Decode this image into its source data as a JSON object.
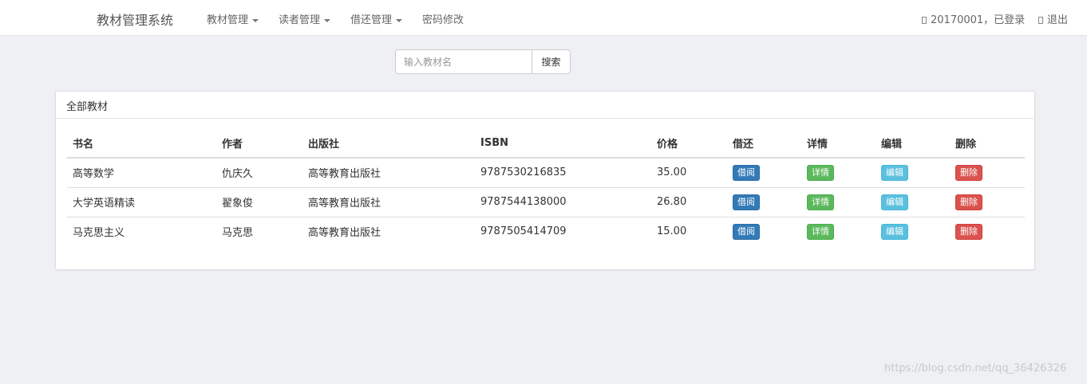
{
  "navbar": {
    "brand": "教材管理系统",
    "menu": [
      {
        "label": "教材管理",
        "dropdown": true
      },
      {
        "label": "读者管理",
        "dropdown": true
      },
      {
        "label": "借还管理",
        "dropdown": true
      },
      {
        "label": "密码修改",
        "dropdown": false
      }
    ],
    "user_status": "20170001，已登录",
    "logout_label": "退出"
  },
  "search": {
    "placeholder": "输入教材名",
    "button_label": "搜索"
  },
  "panel": {
    "title": "全部教材",
    "columns": [
      "书名",
      "作者",
      "出版社",
      "ISBN",
      "价格",
      "借还",
      "详情",
      "编辑",
      "删除"
    ],
    "action_labels": {
      "borrow": "借阅",
      "detail": "详情",
      "edit": "编辑",
      "delete": "删除"
    },
    "rows": [
      {
        "title": "高等数学",
        "author": "仇庆久",
        "publisher": "高等教育出版社",
        "isbn": "9787530216835",
        "price": "35.00"
      },
      {
        "title": "大学英语精读",
        "author": "翟象俊",
        "publisher": "高等教育出版社",
        "isbn": "9787544138000",
        "price": "26.80"
      },
      {
        "title": "马克思主义",
        "author": "马克思",
        "publisher": "高等教育出版社",
        "isbn": "9787505414709",
        "price": "15.00"
      }
    ]
  },
  "watermark": "https://blog.csdn.net/qq_36426326",
  "colors": {
    "background": "#eff0f4",
    "primary": "#337ab7",
    "success": "#5cb85c",
    "info": "#5bc0de",
    "danger": "#d9534f"
  }
}
